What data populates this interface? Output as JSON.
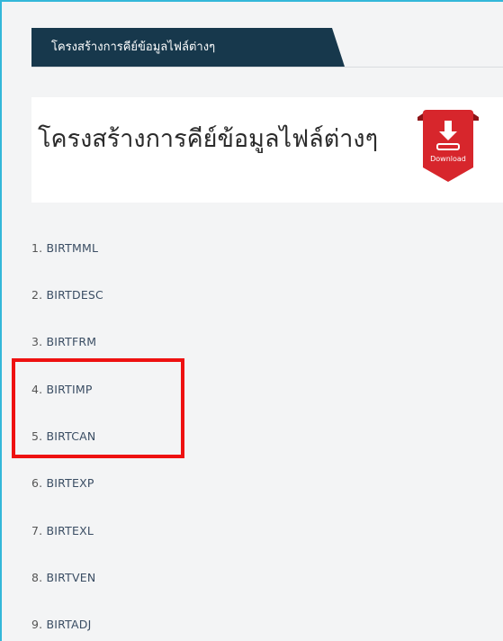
{
  "tab": {
    "label": "โครงสร้างการคีย์ข้อมูลไฟล์ต่างๆ"
  },
  "banner": {
    "title": "โครงสร้างการคีย์ข้อมูลไฟล์ต่างๆ",
    "download_label": "Download",
    "icon": "download-icon"
  },
  "links": [
    {
      "num": "1.",
      "text": "BIRTMML"
    },
    {
      "num": "2.",
      "text": "BIRTDESC"
    },
    {
      "num": "3.",
      "text": "BIRTFRM"
    },
    {
      "num": "4.",
      "text": "BIRTIMP"
    },
    {
      "num": "5.",
      "text": "BIRTCAN"
    },
    {
      "num": "6.",
      "text": "BIRTEXP"
    },
    {
      "num": "7.",
      "text": "BIRTEXL"
    },
    {
      "num": "8.",
      "text": "BIRTVEN"
    },
    {
      "num": "9.",
      "text": "BIRTADJ"
    }
  ],
  "colors": {
    "tab": "#17384c",
    "frame": "#33b7d9",
    "download": "#d7262c",
    "highlight": "#ee1111"
  }
}
